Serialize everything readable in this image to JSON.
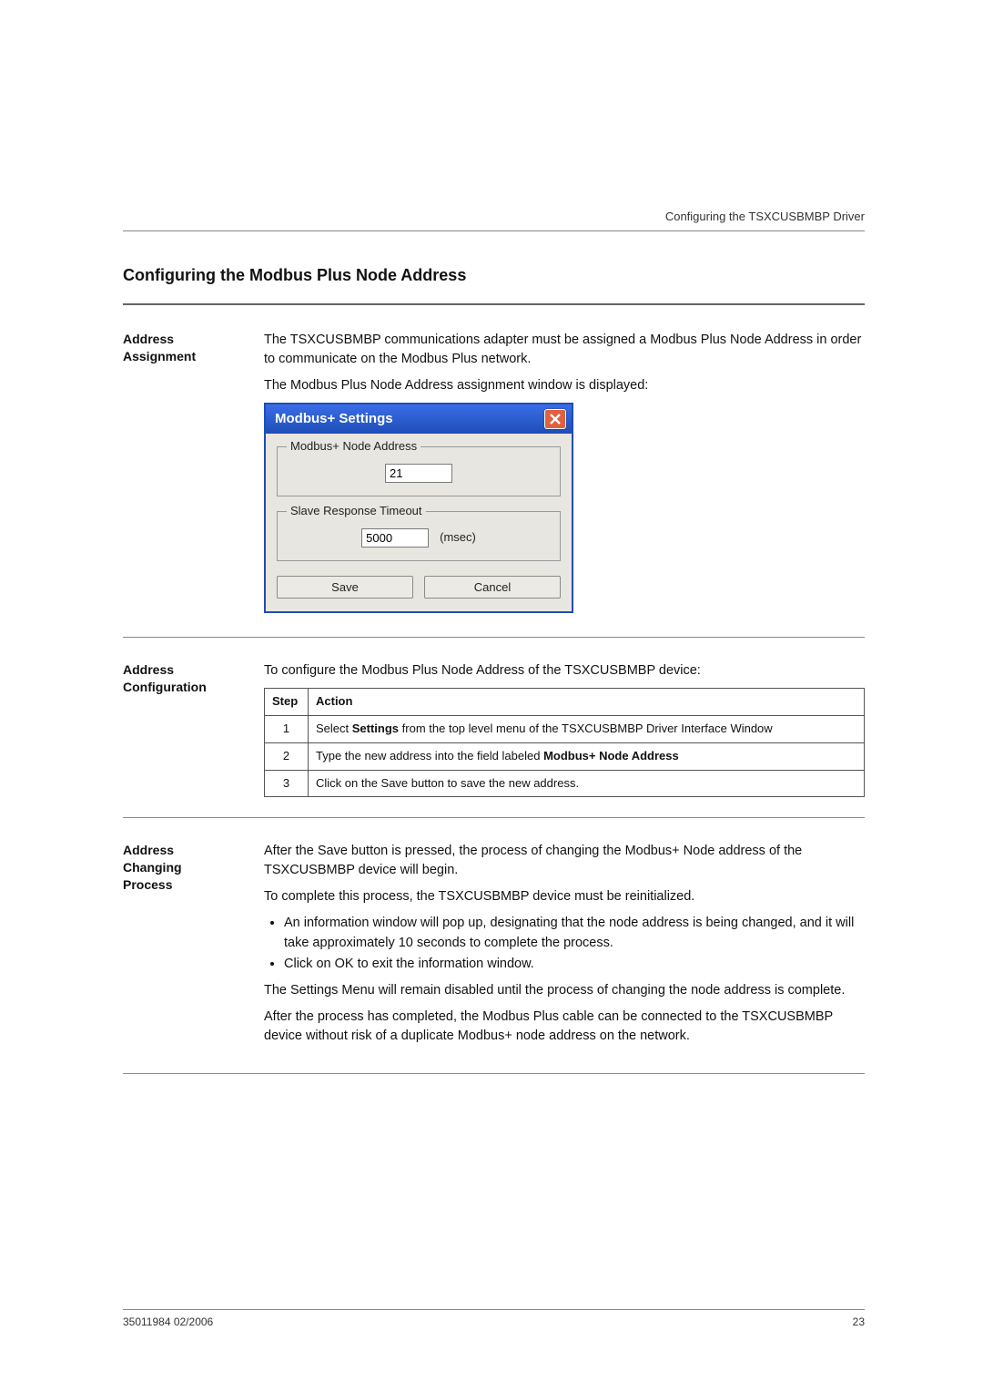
{
  "header": {
    "running_head": "Configuring the TSXCUSBMBP Driver"
  },
  "title": "Configuring the Modbus Plus Node Address",
  "sections": {
    "assignment": {
      "label_line1": "Address",
      "label_line2": "Assignment",
      "para1": "The TSXCUSBMBP communications adapter must be assigned a Modbus Plus Node Address in order to communicate on the Modbus Plus network.",
      "para2": "The Modbus Plus Node Address assignment window is displayed:"
    },
    "dialog": {
      "title": "Modbus+ Settings",
      "field1_label": "Modbus+ Node Address",
      "field1_value": "21",
      "field2_label": "Slave Response Timeout",
      "field2_value": "5000",
      "field2_unit": "(msec)",
      "save_label": "Save",
      "cancel_label": "Cancel"
    },
    "configuration": {
      "label_line1": "Address",
      "label_line2": "Configuration",
      "intro": "To configure the Modbus Plus Node Address of the TSXCUSBMBP device:",
      "head_step": "Step",
      "head_action": "Action",
      "rows": [
        {
          "step": "1",
          "action_pre": "Select ",
          "action_bold": "Settings",
          "action_post": " from the top level menu of the TSXCUSBMBP Driver Interface Window"
        },
        {
          "step": "2",
          "action_pre": "Type the new address into the field labeled ",
          "action_bold": "Modbus+ Node Address",
          "action_post": ""
        },
        {
          "step": "3",
          "action_pre": "Click on the Save button to save the new address.",
          "action_bold": "",
          "action_post": ""
        }
      ]
    },
    "changing": {
      "label_line1": "Address",
      "label_line2": "Changing",
      "label_line3": "Process",
      "para1": "After the Save button is pressed, the process of changing the Modbus+ Node address of the TSXCUSBMBP device will begin.",
      "para2": "To complete this process, the TSXCUSBMBP device must be reinitialized.",
      "bullet1": "An information window will pop up, designating that the node address is being changed, and it will take approximately 10 seconds to complete the process.",
      "bullet2": "Click on OK to exit the information window.",
      "para3": "The Settings Menu will remain disabled until the process of changing the node address is complete.",
      "para4": "After the process has completed, the Modbus Plus cable can be connected to the TSXCUSBMBP device without risk of a duplicate Modbus+ node address on the network."
    }
  },
  "footer": {
    "doc_id": "35011984 02/2006",
    "page": "23"
  }
}
